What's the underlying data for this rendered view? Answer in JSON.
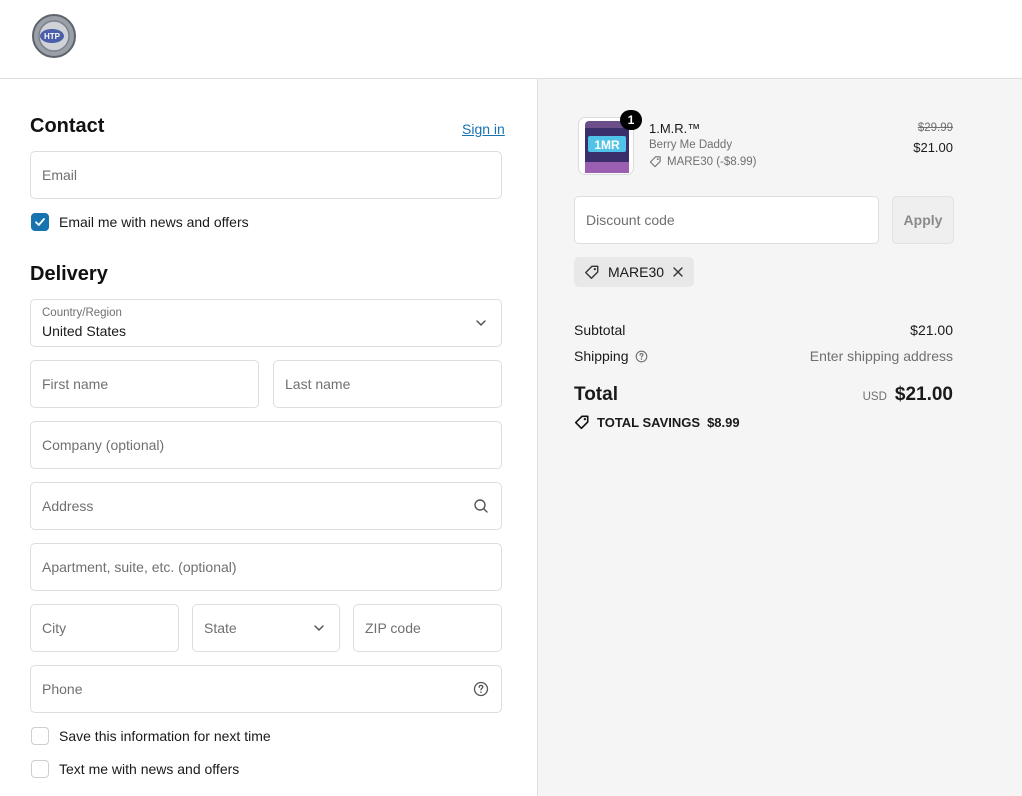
{
  "header": {
    "logo_alt": "store-logo"
  },
  "contact": {
    "title": "Contact",
    "sign_in": "Sign in",
    "email_placeholder": "Email",
    "news_checkbox_label": "Email me with news and offers",
    "news_checked": true
  },
  "delivery": {
    "title": "Delivery",
    "country_label": "Country/Region",
    "country_value": "United States",
    "first_name": "First name",
    "last_name": "Last name",
    "company": "Company (optional)",
    "address": "Address",
    "apartment": "Apartment, suite, etc. (optional)",
    "city": "City",
    "state": "State",
    "zip": "ZIP code",
    "phone": "Phone",
    "save_info": "Save this information for next time",
    "text_me": "Text me with news and offers"
  },
  "order": {
    "item": {
      "qty": "1",
      "name": "1.M.R.™",
      "variant": "Berry Me Daddy",
      "discount": "MARE30 (-$8.99)",
      "old_price": "$29.99",
      "price": "$21.00",
      "thumb_text": "1MR"
    },
    "discount_placeholder": "Discount code",
    "apply": "Apply",
    "applied_code": "MARE30",
    "subtotal_label": "Subtotal",
    "subtotal_value": "$21.00",
    "shipping_label": "Shipping",
    "shipping_value": "Enter shipping address",
    "total_label": "Total",
    "currency": "USD",
    "total_value": "$21.00",
    "savings_label": "TOTAL SAVINGS",
    "savings_value": "$8.99"
  },
  "colors": {
    "accent": "#1773b0",
    "border": "#dedede",
    "sidebar_bg": "#f5f5f5"
  },
  "icons": [
    "logo-icon",
    "checkbox-check-icon",
    "chevron-down-icon",
    "search-icon",
    "help-circle-icon",
    "tag-icon",
    "close-icon"
  ]
}
